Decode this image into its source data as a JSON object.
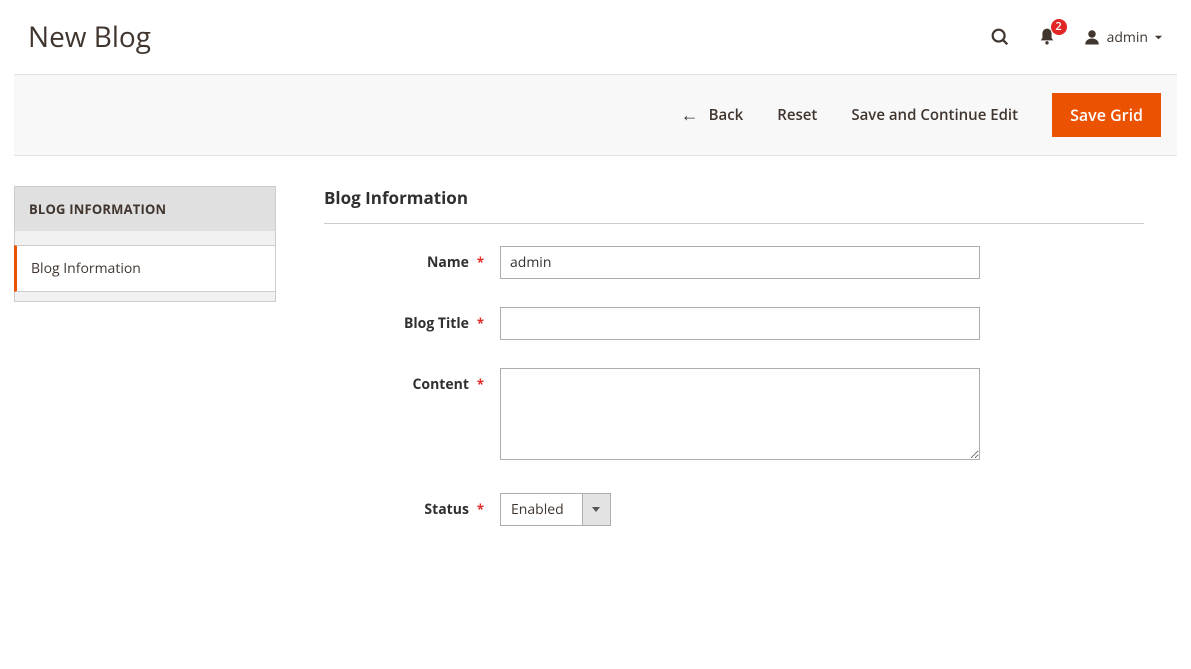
{
  "header": {
    "page_title": "New Blog",
    "notification_count": "2",
    "user_label": "admin"
  },
  "actions": {
    "back_label": "Back",
    "reset_label": "Reset",
    "save_continue_label": "Save and Continue Edit",
    "save_grid_label": "Save Grid"
  },
  "sidebar": {
    "header": "BLOG INFORMATION",
    "items": [
      {
        "label": "Blog Information"
      }
    ]
  },
  "form": {
    "section_title": "Blog Information",
    "fields": {
      "name": {
        "label": "Name",
        "value": "admin"
      },
      "blog_title": {
        "label": "Blog Title",
        "value": ""
      },
      "content": {
        "label": "Content",
        "value": ""
      },
      "status": {
        "label": "Status",
        "value": "Enabled"
      }
    }
  }
}
